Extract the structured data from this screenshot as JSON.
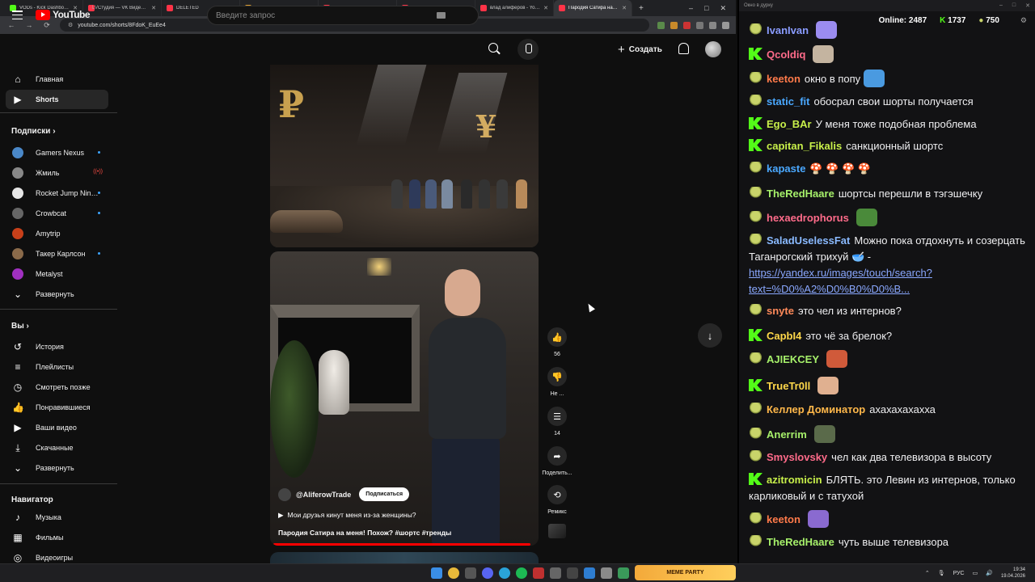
{
  "browser": {
    "tabs": [
      {
        "title": "VODs - Kick Dashboard",
        "color": "#53fc18"
      },
      {
        "title": "Студия — VK Видео Live",
        "color": "#ff3347"
      },
      {
        "title": "DELETED",
        "color": "#ff3347"
      },
      {
        "title": "ДЕИГРА",
        "color": "#e0a030"
      },
      {
        "title": "«Черные вдовы» реше…",
        "color": "#ff3347"
      },
      {
        "title": "ТУПЕЙШИЕ БЕЛЫЕ ТЕ…",
        "color": "#ff3347"
      },
      {
        "title": "влад алиферов - YouTube",
        "color": "#ff3347"
      },
      {
        "title": "Пародия Сатира на м…",
        "color": "#ff3347",
        "active": true
      }
    ],
    "new_tab": "+",
    "window_controls": {
      "minimize": "–",
      "maximize": "□",
      "close": "✕"
    },
    "nav": {
      "back": "←",
      "forward": "→",
      "reload": "⟳"
    },
    "url": "youtube.com/shorts/8FdoK_EuEe4"
  },
  "youtube": {
    "logo_text": "YouTube",
    "logo_country": "LV",
    "search_placeholder": "Введите запрос",
    "create_label": "Создать",
    "sidebar": {
      "main": [
        {
          "label": "Главная",
          "icon": "⌂"
        },
        {
          "label": "Shorts",
          "icon": "▶",
          "active": true
        }
      ],
      "subscriptions_header": "Подписки",
      "subscriptions": [
        {
          "label": "Gamers Nexus",
          "color": "#4a88c8",
          "dot": true
        },
        {
          "label": "Жмиль",
          "color": "#888",
          "live": true
        },
        {
          "label": "Rocket Jump Nin…",
          "color": "#e6e6e6",
          "dot": true
        },
        {
          "label": "Crowbcat",
          "color": "#666",
          "dot": true
        },
        {
          "label": "Amytrip",
          "color": "#c8401a"
        },
        {
          "label": "Такер Карлсон",
          "color": "#8a6a4a",
          "dot": true
        },
        {
          "label": "Metalyst",
          "color": "#a030c0"
        }
      ],
      "expand_subs": "Развернуть",
      "you_header": "Вы",
      "you_items": [
        {
          "label": "История",
          "icon": "↺"
        },
        {
          "label": "Плейлисты",
          "icon": "≡"
        },
        {
          "label": "Смотреть позже",
          "icon": "◷"
        },
        {
          "label": "Понравившиеся",
          "icon": "👍"
        },
        {
          "label": "Ваши видео",
          "icon": "▶"
        },
        {
          "label": "Скачанные",
          "icon": "⤓"
        },
        {
          "label": "Развернуть",
          "icon": "⌄"
        }
      ],
      "nav_header": "Навигатор",
      "nav_items": [
        {
          "label": "Музыка",
          "icon": "♪"
        },
        {
          "label": "Фильмы",
          "icon": "▦"
        },
        {
          "label": "Видеоигры",
          "icon": "◎"
        }
      ]
    },
    "short": {
      "channel": "@AliferowTrade",
      "subscribe": "Подписаться",
      "music": "Мои друзья кинут меня из-за женщины?",
      "title": "Пародия Сатира на меня! Похож? #шортс #тренды",
      "progress": 0.98,
      "top_scene_symbols": {
        "ruble": "₽",
        "yen": "¥"
      }
    },
    "actions": [
      {
        "name": "like",
        "icon": "👍",
        "caption": "56"
      },
      {
        "name": "dislike",
        "icon": "👎",
        "caption": "Не ..."
      },
      {
        "name": "comments",
        "icon": "☰",
        "caption": "14"
      },
      {
        "name": "share",
        "icon": "➦",
        "caption": "Поделить..."
      },
      {
        "name": "remix",
        "icon": "⟲",
        "caption": "Ремикс"
      }
    ],
    "next_button": "↓"
  },
  "chat": {
    "window_title": "Окно в дурку",
    "online_label": "Online:",
    "online_count": "2487",
    "kick_count": "1737",
    "frog_count": "750",
    "messages": [
      {
        "badge": "frog",
        "user": "IvanIvan",
        "color": "#8a9cff",
        "text": "",
        "emote": "#9b8cf0"
      },
      {
        "badge": "kick",
        "user": "Qcoldiq",
        "color": "#ff6b8a",
        "text": "",
        "emote": "#c4b4a0"
      },
      {
        "badge": "frog",
        "user": "keeton",
        "color": "#ff7a4a",
        "text": "окно в попу",
        "emote": "#4a9ae0"
      },
      {
        "badge": "frog",
        "user": "static_fit",
        "color": "#4aa8ff",
        "text": "обосрал свои шорты получается"
      },
      {
        "badge": "kick",
        "user": "Ego_BAr",
        "color": "#c8f04a",
        "text": "У меня тоже подобная проблема"
      },
      {
        "badge": "kick",
        "user": "capitan_Fikalis",
        "color": "#c8f04a",
        "text": "санкционный шортс"
      },
      {
        "badge": "frog",
        "user": "kapaste",
        "color": "#4aa8ff",
        "text": "🍄 🍄 🍄 🍄"
      },
      {
        "badge": "frog",
        "user": "TheRedHaare",
        "color": "#a6f06a",
        "text": "шортсы перешли в тэгэшечку"
      },
      {
        "badge": "frog",
        "user": "hexaedrophorus",
        "color": "#ff6b8a",
        "text": "",
        "emote": "#4a8a3a"
      },
      {
        "badge": "frog",
        "user": "SaladUselessFat",
        "color": "#8abaff",
        "text": "Можно пока отдохнуть и созерцать Таганрогский трихуй 🥣 -",
        "link": "https://yandex.ru/images/touch/search?text=%D0%A2%D0%B0%D0%B..."
      },
      {
        "badge": "frog",
        "user": "snyte",
        "color": "#ff8a5a",
        "text": "это чел из интернов?"
      },
      {
        "badge": "kick",
        "user": "CapbI4",
        "color": "#ffd84a",
        "text": "это чё за брелок?"
      },
      {
        "badge": "frog",
        "user": "AJIEKCEY",
        "color": "#a6f06a",
        "text": "",
        "emote": "#d05a3a"
      },
      {
        "badge": "kick",
        "user": "TrueTr0ll",
        "color": "#ffd84a",
        "text": "",
        "emote": "#e0b090"
      },
      {
        "badge": "frog",
        "user": "Келлер Доминатор",
        "color": "#ffb84a",
        "text": "ахахахахахха"
      },
      {
        "badge": "frog",
        "user": "Anerrim",
        "color": "#a6f06a",
        "text": "",
        "emote": "#5a6a4a"
      },
      {
        "badge": "frog",
        "user": "Smyslovsky",
        "color": "#ff6b8a",
        "text": "чел как два телевизора в высоту"
      },
      {
        "badge": "kick",
        "user": "azitromicin",
        "color": "#c8f04a",
        "text": "БЛЯТЬ. это Левин из интернов, только карликовый и с татухой"
      },
      {
        "badge": "frog",
        "user": "keeton",
        "color": "#ff7a4a",
        "text": "",
        "emote": "#8a6ad0"
      },
      {
        "badge": "frog",
        "user": "TheRedHaare",
        "color": "#a6f06a",
        "text": "чуть выше телевизора"
      }
    ]
  },
  "taskbar": {
    "banner": "MEME PARTY",
    "lang": "РУС",
    "time": "19:34",
    "date": "19.04.2026"
  }
}
